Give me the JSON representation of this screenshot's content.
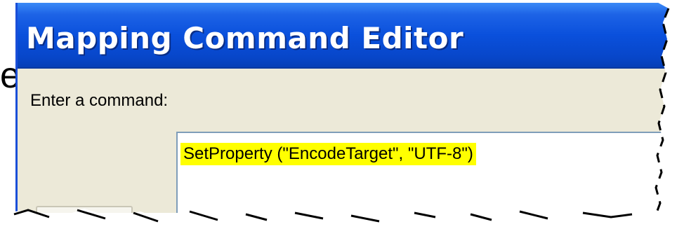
{
  "window": {
    "title": "Mapping Command Editor"
  },
  "edge_fragment": "e",
  "form": {
    "prompt_label": "Enter a command:",
    "command_value": "SetProperty (\"EncodeTarget\", \"UTF-8\")"
  },
  "colors": {
    "titlebar": "#0a50dc",
    "window_bg": "#ece9d8",
    "highlight": "#ffff00"
  }
}
